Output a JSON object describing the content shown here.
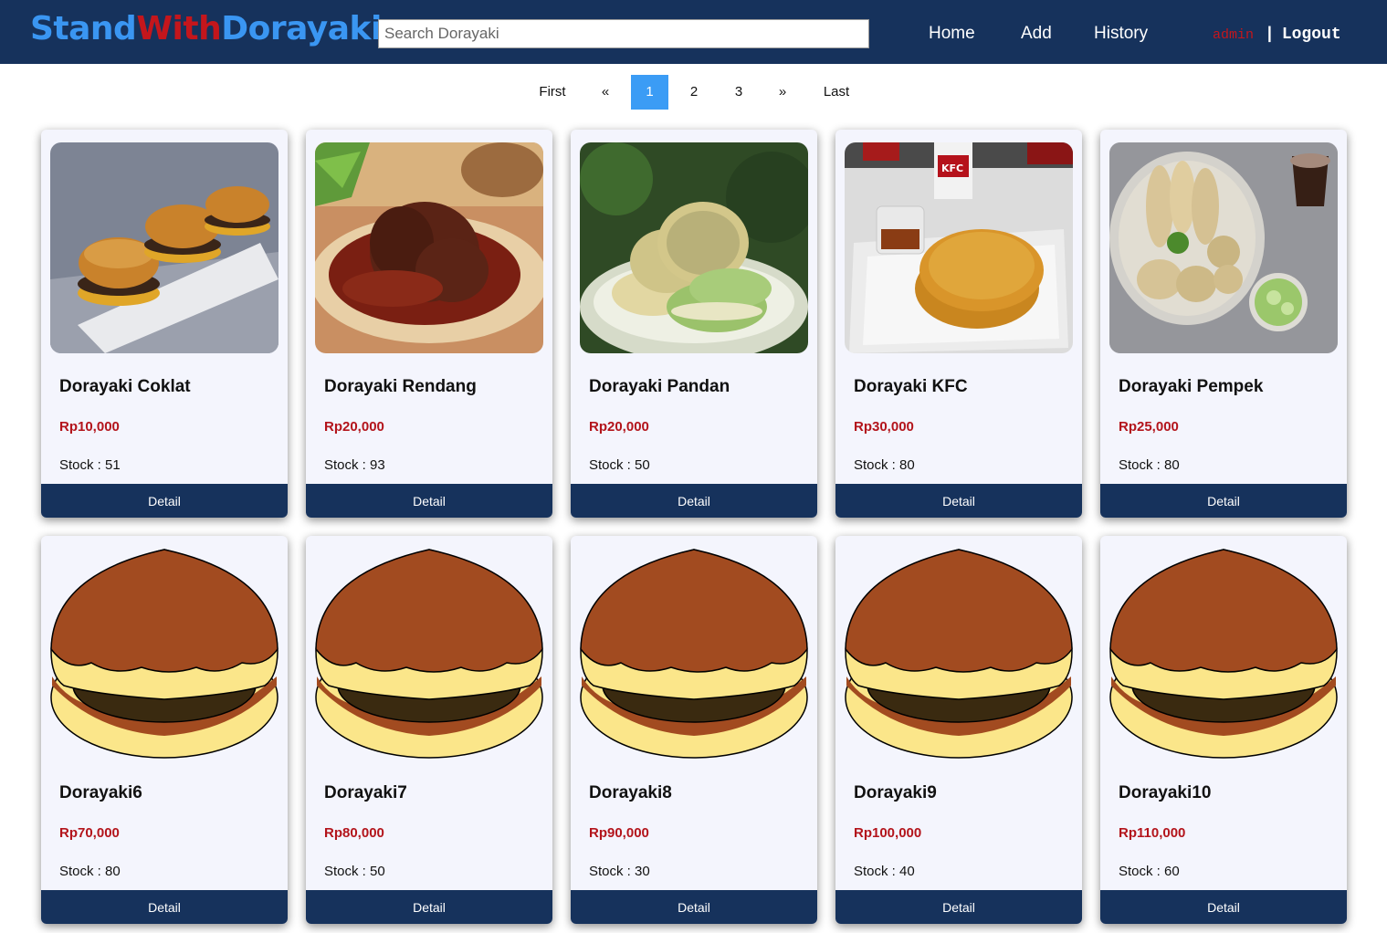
{
  "brand": {
    "part1": "Stand",
    "part2": "With",
    "part3": "Dorayaki"
  },
  "search": {
    "placeholder": "Search Dorayaki",
    "value": ""
  },
  "nav": {
    "home": "Home",
    "add": "Add",
    "history": "History"
  },
  "user": {
    "name": "admin",
    "separator": "|",
    "logout": "Logout"
  },
  "pagination": {
    "first": "First",
    "prev": "«",
    "pages": [
      "1",
      "2",
      "3"
    ],
    "current": "1",
    "next": "»",
    "last": "Last"
  },
  "products": [
    {
      "name": "Dorayaki Coklat",
      "price": "Rp10,000",
      "stock": "Stock : 51",
      "detail": "Detail",
      "image": "dorayaki-coklat-photo"
    },
    {
      "name": "Dorayaki Rendang",
      "price": "Rp20,000",
      "stock": "Stock : 93",
      "detail": "Detail",
      "image": "rendang-photo"
    },
    {
      "name": "Dorayaki Pandan",
      "price": "Rp20,000",
      "stock": "Stock : 50",
      "detail": "Detail",
      "image": "pandan-pancake-photo"
    },
    {
      "name": "Dorayaki KFC",
      "price": "Rp30,000",
      "stock": "Stock : 80",
      "detail": "Detail",
      "image": "kfc-pancake-photo"
    },
    {
      "name": "Dorayaki Pempek",
      "price": "Rp25,000",
      "stock": "Stock : 80",
      "detail": "Detail",
      "image": "pempek-photo"
    },
    {
      "name": "Dorayaki6",
      "price": "Rp70,000",
      "stock": "Stock : 80",
      "detail": "Detail",
      "image": "dorayaki-illustration"
    },
    {
      "name": "Dorayaki7",
      "price": "Rp80,000",
      "stock": "Stock : 50",
      "detail": "Detail",
      "image": "dorayaki-illustration"
    },
    {
      "name": "Dorayaki8",
      "price": "Rp90,000",
      "stock": "Stock : 30",
      "detail": "Detail",
      "image": "dorayaki-illustration"
    },
    {
      "name": "Dorayaki9",
      "price": "Rp100,000",
      "stock": "Stock : 40",
      "detail": "Detail",
      "image": "dorayaki-illustration"
    },
    {
      "name": "Dorayaki10",
      "price": "Rp110,000",
      "stock": "Stock : 60",
      "detail": "Detail",
      "image": "dorayaki-illustration"
    }
  ],
  "colors": {
    "navbar": "#16325c",
    "brand_blue": "#3a96f2",
    "brand_red": "#c4161c",
    "price_red": "#b3141b",
    "active_page": "#3b9cf5",
    "card_bg": "#f4f5fd"
  }
}
